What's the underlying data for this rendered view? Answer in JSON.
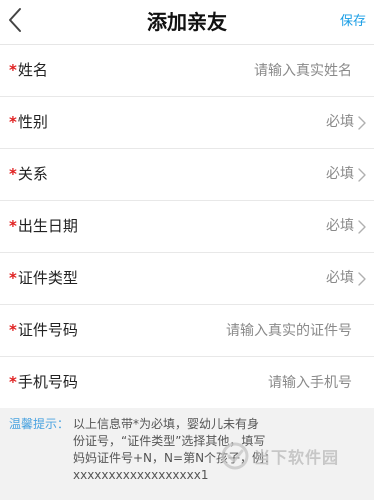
{
  "nav": {
    "title": "添加亲友",
    "save_label": "保存"
  },
  "form": {
    "required_mark": "*",
    "rows": [
      {
        "label": "姓名",
        "placeholder": "请输入真实姓名"
      },
      {
        "label": "性别",
        "value": "必填"
      },
      {
        "label": "关系",
        "value": "必填"
      },
      {
        "label": "出生日期",
        "value": "必填"
      },
      {
        "label": "证件类型",
        "value": "必填"
      },
      {
        "label": "证件号码",
        "placeholder": "请输入真实的证件号"
      },
      {
        "label": "手机号码",
        "placeholder": "请输入手机号"
      }
    ]
  },
  "tip": {
    "label": "温馨提示：",
    "lines": [
      "以上信息带*为必填，婴幼儿未有身",
      "份证号，“证件类型”选择其他，填写",
      "妈妈证件号+N，N=第N个孩子，例：",
      "xxxxxxxxxxxxxxxxxx1"
    ]
  },
  "watermark": {
    "text": "当下软件园"
  },
  "colors": {
    "accent": "#1a9ee6",
    "required": "#e02020",
    "tip_label": "#4aa3e0",
    "tip_bg": "#f2f2f2"
  }
}
